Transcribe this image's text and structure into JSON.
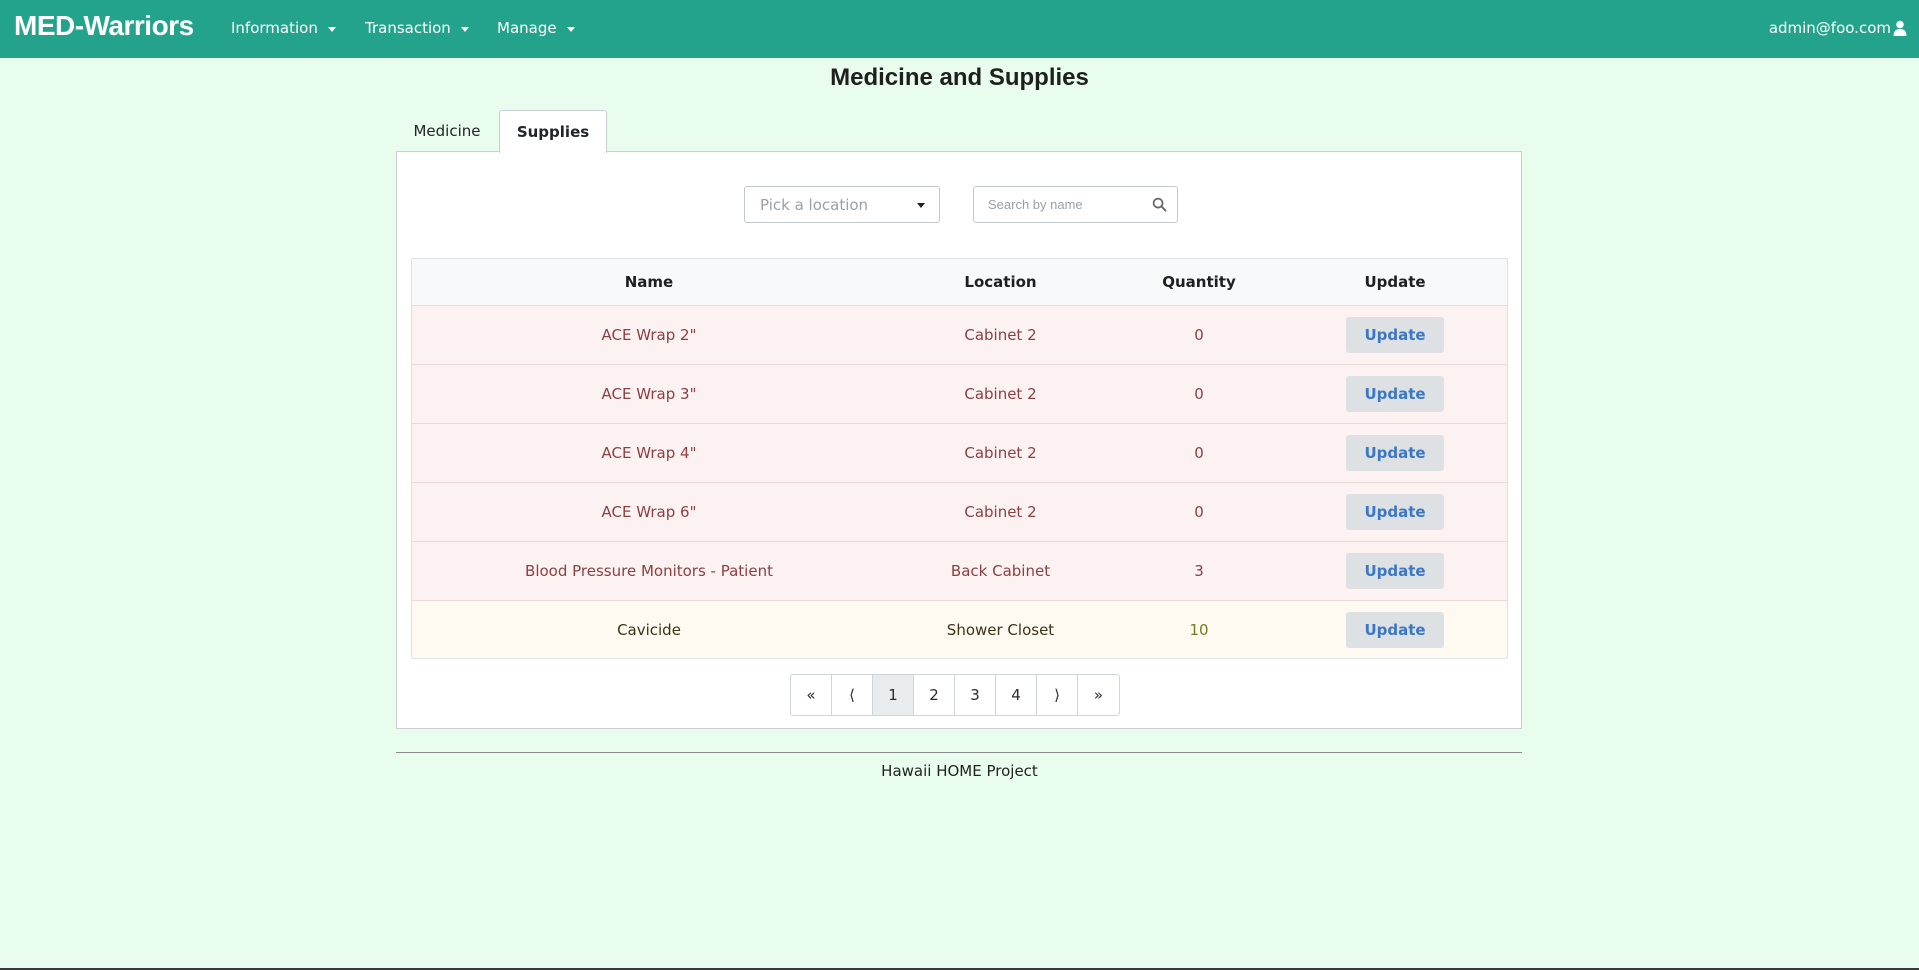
{
  "navbar": {
    "brand": "MED-Warriors",
    "menus": [
      "Information",
      "Transaction",
      "Manage"
    ],
    "user": "admin@foo.com",
    "user_icon": "user-icon",
    "bg_color": "#24a38c"
  },
  "page": {
    "title": "Medicine and Supplies"
  },
  "tabs": [
    {
      "label": "Medicine",
      "active": false
    },
    {
      "label": "Supplies",
      "active": true
    }
  ],
  "filters": {
    "location_placeholder": "Pick a location",
    "search_placeholder": "Search by name",
    "search_value": ""
  },
  "table": {
    "headers": [
      "Name",
      "Location",
      "Quantity",
      "Update"
    ],
    "rows": [
      {
        "name": "ACE Wrap 2\"",
        "location": "Cabinet 2",
        "quantity": "0",
        "status": "danger",
        "action": "Update"
      },
      {
        "name": "ACE Wrap 3\"",
        "location": "Cabinet 2",
        "quantity": "0",
        "status": "danger",
        "action": "Update"
      },
      {
        "name": "ACE Wrap 4\"",
        "location": "Cabinet 2",
        "quantity": "0",
        "status": "danger",
        "action": "Update"
      },
      {
        "name": "ACE Wrap 6\"",
        "location": "Cabinet 2",
        "quantity": "0",
        "status": "danger",
        "action": "Update"
      },
      {
        "name": "Blood Pressure Monitors - Patient",
        "location": "Back Cabinet",
        "quantity": "3",
        "status": "danger",
        "action": "Update"
      },
      {
        "name": "Cavicide",
        "location": "Shower Closet",
        "quantity": "10",
        "status": "warning",
        "action": "Update"
      }
    ]
  },
  "pagination": {
    "first": "«",
    "prev": "⟨",
    "pages": [
      "1",
      "2",
      "3",
      "4"
    ],
    "current": "1",
    "next": "⟩",
    "last": "»"
  },
  "footer": {
    "text": "Hawaii HOME Project"
  }
}
